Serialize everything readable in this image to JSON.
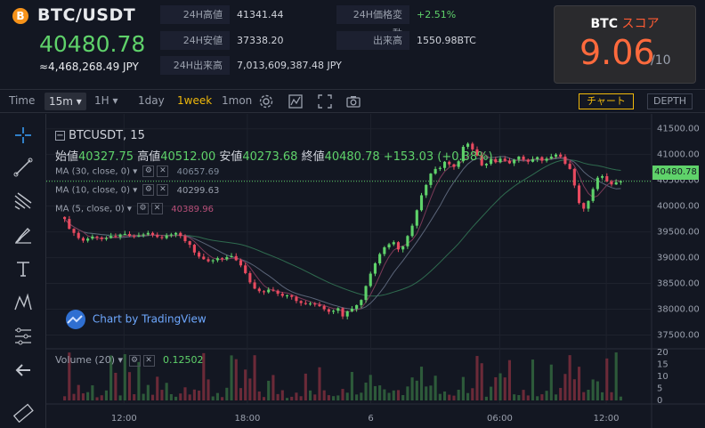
{
  "header": {
    "coin_symbol": "B",
    "pair": "BTC/USDT",
    "price": "40480.78",
    "jpy": "≈4,468,268.49 JPY",
    "stats": {
      "high_label": "24H高値",
      "high_value": "41341.44",
      "low_label": "24H安値",
      "low_value": "37338.20",
      "vol_label": "24H出来高",
      "vol_value": "7,013,609,387.48 JPY",
      "change_label": "24H価格変動",
      "change_value": "+2.51%",
      "amount_label": "出来高",
      "amount_value": "1550.98BTC"
    },
    "score": {
      "coin": "BTC",
      "label": "スコア",
      "value": "9.06",
      "denominator": "/10"
    }
  },
  "toolbar": {
    "time_label": "Time",
    "interval_selected": "15m",
    "interval_1h": "1H",
    "day": "1day",
    "week": "1week",
    "month": "1mon",
    "chart_button": "チャート",
    "depth_button": "DEPTH"
  },
  "chart": {
    "symbol": "BTCUSDT, 15",
    "open_label": "始値",
    "open": "40327.75",
    "high_label": "高値",
    "high": "40512.00",
    "low_label": "安値",
    "low": "40273.68",
    "close_label": "終値",
    "close": "40480.78",
    "change": "+153.03 (+0.38%)",
    "ma30": {
      "label": "MA (30, close, 0)",
      "value": "40657.69"
    },
    "ma10": {
      "label": "MA (10, close, 0)",
      "value": "40299.63"
    },
    "ma5": {
      "label": "MA (5, close, 0)",
      "value": "40389.96"
    },
    "watermark": "Chart by TradingView",
    "current_price_tag": "40480.78",
    "volume_label": "Volume (20)",
    "volume_value": "0.12502",
    "price_ticks": [
      "41500.00",
      "41000.00",
      "40500.00",
      "40000.00",
      "39500.00",
      "39000.00",
      "38500.00",
      "38000.00",
      "37500.00"
    ],
    "volume_ticks": [
      "20",
      "15",
      "10",
      "5",
      "0"
    ],
    "time_ticks": [
      "12:00",
      "18:00",
      "6",
      "06:00",
      "12:00"
    ]
  },
  "chart_data": {
    "type": "candlestick",
    "ylim": [
      37250,
      41650
    ],
    "closes": [
      39750,
      39560,
      39480,
      39380,
      39330,
      39370,
      39410,
      39390,
      39360,
      39380,
      39420,
      39400,
      39450,
      39460,
      39420,
      39410,
      39430,
      39450,
      39480,
      39440,
      39400,
      39380,
      39430,
      39450,
      39480,
      39420,
      39320,
      39250,
      39100,
      39020,
      38970,
      38930,
      38950,
      38990,
      38970,
      39010,
      39030,
      38950,
      38850,
      38700,
      38520,
      38400,
      38350,
      38330,
      38380,
      38360,
      38300,
      38260,
      38270,
      38240,
      38160,
      38120,
      38100,
      38110,
      38090,
      38060,
      38000,
      37950,
      37970,
      38020,
      37860,
      37960,
      38010,
      38080,
      38180,
      38450,
      38690,
      38890,
      39070,
      39200,
      39260,
      39300,
      39160,
      39220,
      39420,
      39620,
      39920,
      40210,
      40410,
      40630,
      40720,
      40740,
      40860,
      40810,
      40760,
      40870,
      41150,
      41210,
      41100,
      40980,
      40790,
      40820,
      40910,
      40850,
      40920,
      40880,
      40830,
      40900,
      40960,
      40900,
      40860,
      40910,
      40950,
      40880,
      40920,
      40960,
      41000,
      40960,
      40820,
      40720,
      40400,
      40060,
      39950,
      40100,
      40330,
      40550,
      40580,
      40480,
      40420,
      40460,
      40480
    ],
    "volume_range": [
      0,
      20
    ]
  }
}
